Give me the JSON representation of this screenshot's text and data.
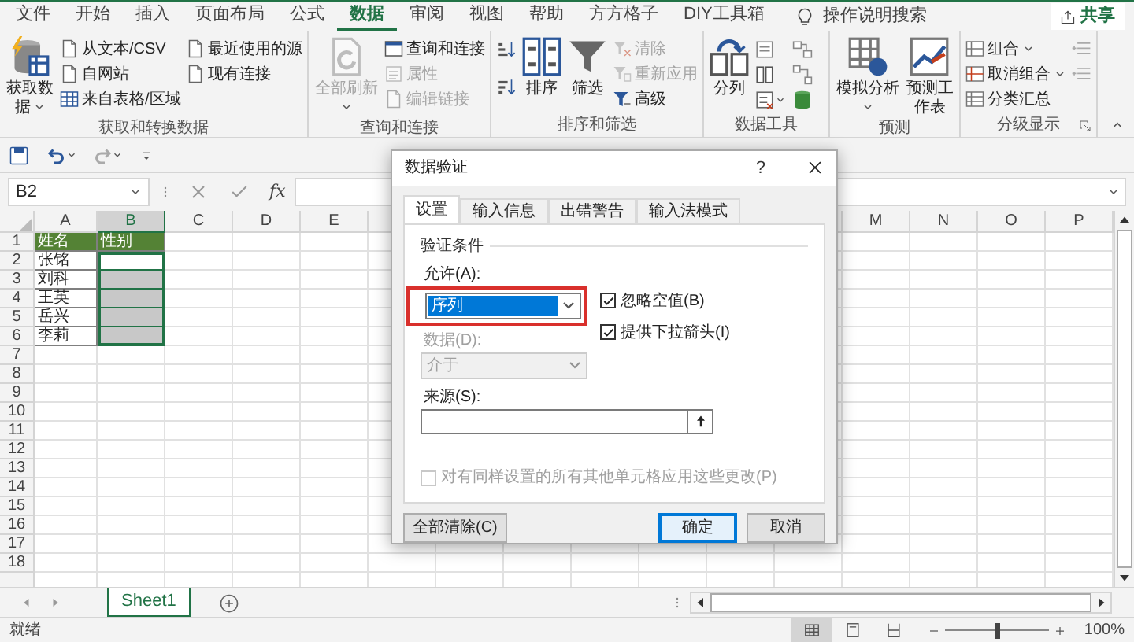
{
  "ribbon_tabs": [
    {
      "label": "文件",
      "selected": false
    },
    {
      "label": "开始",
      "selected": false
    },
    {
      "label": "插入",
      "selected": false
    },
    {
      "label": "页面布局",
      "selected": false
    },
    {
      "label": "公式",
      "selected": false
    },
    {
      "label": "数据",
      "selected": true
    },
    {
      "label": "审阅",
      "selected": false
    },
    {
      "label": "视图",
      "selected": false
    },
    {
      "label": "帮助",
      "selected": false
    },
    {
      "label": "方方格子",
      "selected": false
    },
    {
      "label": "DIY工具箱",
      "selected": false
    }
  ],
  "tell_me": "操作说明搜索",
  "share_button": "共享",
  "ribbon_groups": [
    {
      "label": "获取和转换数据",
      "buttons": [
        {
          "label": "获取数据",
          "disabled": false
        },
        {
          "label": "从文本/CSV",
          "disabled": false
        },
        {
          "label": "自网站",
          "disabled": false
        },
        {
          "label": "来自表格/区域",
          "disabled": false
        },
        {
          "label": "最近使用的源",
          "disabled": false
        },
        {
          "label": "现有连接",
          "disabled": false
        }
      ]
    },
    {
      "label": "查询和连接",
      "buttons": [
        {
          "label": "全部刷新",
          "disabled": true
        },
        {
          "label": "查询和连接",
          "disabled": false
        },
        {
          "label": "属性",
          "disabled": true
        },
        {
          "label": "编辑链接",
          "disabled": true
        }
      ]
    },
    {
      "label": "排序和筛选",
      "buttons": [
        {
          "label": "排序",
          "disabled": false
        },
        {
          "label": "筛选",
          "disabled": false
        },
        {
          "label": "清除",
          "disabled": true
        },
        {
          "label": "重新应用",
          "disabled": true
        },
        {
          "label": "高级",
          "disabled": false
        }
      ]
    },
    {
      "label": "数据工具",
      "buttons": [
        {
          "label": "分列",
          "disabled": false
        }
      ]
    },
    {
      "label": "预测",
      "buttons": [
        {
          "label": "模拟分析",
          "disabled": false
        },
        {
          "label": "预测工作表",
          "disabled": false
        }
      ]
    },
    {
      "label": "分级显示",
      "buttons": [
        {
          "label": "组合",
          "disabled": false
        },
        {
          "label": "取消组合",
          "disabled": false
        },
        {
          "label": "分类汇总",
          "disabled": false
        }
      ]
    }
  ],
  "name_box": "B2",
  "function_button": "fx",
  "sheet": {
    "columns": [
      {
        "label": "A",
        "selected": false
      },
      {
        "label": "B",
        "selected": true
      },
      {
        "label": "C",
        "selected": false
      },
      {
        "label": "D",
        "selected": false
      },
      {
        "label": "E",
        "selected": false
      },
      {
        "label": "M",
        "selected": false
      },
      {
        "label": "N",
        "selected": false
      },
      {
        "label": "O",
        "selected": false
      },
      {
        "label": "P",
        "selected": false
      }
    ],
    "header_row": {
      "number": "1",
      "cells": [
        "姓名",
        "性别"
      ]
    },
    "rows": [
      {
        "number": "2",
        "name": "张铭",
        "selected": true,
        "active": true
      },
      {
        "number": "3",
        "name": "刘科",
        "selected": true,
        "active": false
      },
      {
        "number": "4",
        "name": "王英",
        "selected": true,
        "active": false
      },
      {
        "number": "5",
        "name": "岳兴",
        "selected": true,
        "active": false
      },
      {
        "number": "6",
        "name": "李莉",
        "selected": true,
        "active": false
      }
    ],
    "empty_rows": [
      "7",
      "8",
      "9",
      "10",
      "11",
      "12",
      "13",
      "14",
      "15",
      "16",
      "17",
      "18"
    ]
  },
  "dialog": {
    "title": "数据验证",
    "help": "?",
    "tabs": [
      {
        "label": "设置",
        "selected": true
      },
      {
        "label": "输入信息",
        "selected": false
      },
      {
        "label": "出错警告",
        "selected": false
      },
      {
        "label": "输入法模式",
        "selected": false
      }
    ],
    "section_title": "验证条件",
    "allow_label": "允许(A):",
    "allow_value": "序列",
    "ignore_blank": {
      "label": "忽略空值(B)",
      "checked": true
    },
    "in_cell_dropdown": {
      "label": "提供下拉箭头(I)",
      "checked": true
    },
    "data_label": "数据(D):",
    "data_value": "介于",
    "data_disabled": true,
    "source_label": "来源(S):",
    "apply_all": {
      "label": "对有同样设置的所有其他单元格应用这些更改(P)",
      "checked": false,
      "disabled": true
    },
    "buttons": [
      {
        "label": "全部清除(C)",
        "kind": "plain"
      },
      {
        "label": "确定",
        "kind": "default"
      },
      {
        "label": "取消",
        "kind": "plain"
      }
    ]
  },
  "sheet_tabs": [
    {
      "label": "Sheet1",
      "selected": true
    }
  ],
  "status": {
    "text": "就绪",
    "views": [
      {
        "selected": true
      },
      {
        "selected": false
      },
      {
        "selected": false
      }
    ],
    "zoom": {
      "level": 0.5,
      "reading": "100%"
    }
  }
}
